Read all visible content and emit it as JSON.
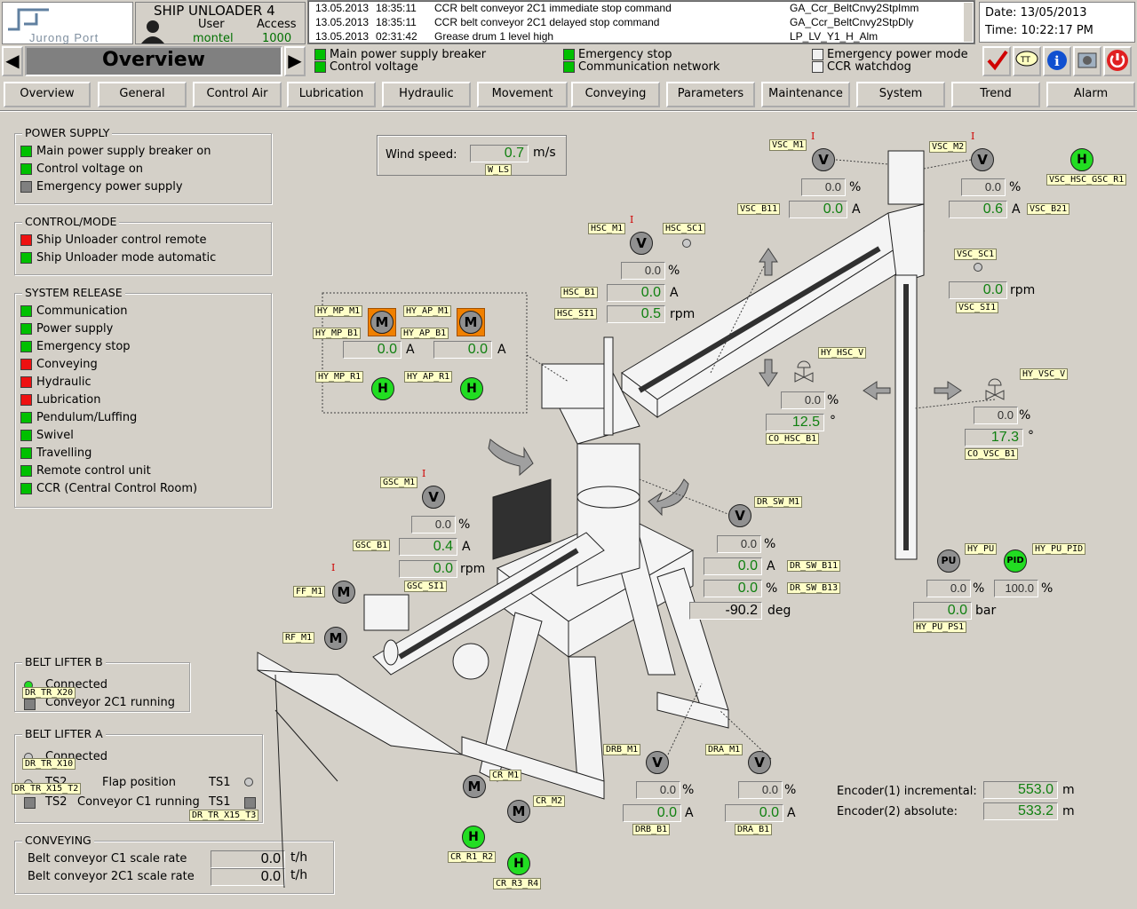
{
  "header": {
    "logo_text": "Jurong Port",
    "title": "SHIP UNLOADER 4",
    "user_label": "User",
    "user_value": "montel",
    "access_label": "Access",
    "access_value": "1000",
    "date": "Date: 13/05/2013",
    "time": "Time: 10:22:17 PM",
    "screen_title": "Overview"
  },
  "alarms": [
    {
      "date": "13.05.2013",
      "time": "18:35:11",
      "text": "CCR belt conveyor 2C1 immediate stop command",
      "tag": "GA_Ccr_BeltCnvy2StpImm"
    },
    {
      "date": "13.05.2013",
      "time": "18:35:11",
      "text": "CCR belt conveyor 2C1 delayed stop command",
      "tag": "GA_Ccr_BeltCnvy2StpDly"
    },
    {
      "date": "13.05.2013",
      "time": "02:31:42",
      "text": "Grease drum 1 level high",
      "tag": "LP_LV_Y1_H_Alm"
    }
  ],
  "status": {
    "c1": [
      "Main power supply breaker",
      "Control voltage"
    ],
    "c2": [
      "Emergency stop",
      "Communication network"
    ],
    "c3": [
      "Emergency power mode",
      "CCR watchdog"
    ]
  },
  "nav": [
    "Overview",
    "General",
    "Control Air",
    "Lubrication",
    "Hydraulic",
    "Movement",
    "Conveying",
    "Parameters",
    "Maintenance",
    "System",
    "Trend",
    "Alarm"
  ],
  "power_supply": {
    "title": "POWER SUPPLY",
    "items": [
      "Main power supply breaker on",
      "Control voltage on",
      "Emergency power supply"
    ]
  },
  "control_mode": {
    "title": "CONTROL/MODE",
    "items": [
      "Ship Unloader control remote",
      "Ship Unloader mode automatic"
    ]
  },
  "system_release": {
    "title": "SYSTEM RELEASE",
    "items": [
      "Communication",
      "Power supply",
      "Emergency stop",
      "Conveying",
      "Hydraulic",
      "Lubrication",
      "Pendulum/Luffing",
      "Swivel",
      "Travelling",
      "Remote control unit",
      "CCR (Central Control Room)"
    ]
  },
  "belt_lifter_b": {
    "title": "BELT LIFTER B",
    "items": [
      "Connected",
      "Conveyor 2C1 running"
    ],
    "tag": "DR_TR_X20"
  },
  "belt_lifter_a": {
    "title": "BELT LIFTER A",
    "connected": "Connected",
    "ts2a": "TS2",
    "flap": "Flap position",
    "ts1a": "TS1",
    "ts2b": "TS2",
    "conv": "Conveyor C1 running",
    "ts1b": "TS1",
    "tags": [
      "DR_TR_X10",
      "DR_TR_X15_T2",
      "DR_TR_X15_T3"
    ]
  },
  "conveying": {
    "title": "CONVEYING",
    "c1": "Belt conveyor C1 scale rate",
    "c1_val": "0.0",
    "c2": "Belt conveyor 2C1 scale rate",
    "c2_val": "0.0",
    "unit": "t/h"
  },
  "wind": {
    "label": "Wind speed:",
    "value": "0.7",
    "unit": "m/s",
    "tag": "W_LS"
  },
  "hyd": {
    "mp_m1": "HY_MP_M1",
    "ap_m1": "HY_AP_M1",
    "mp_b1": "HY_MP_B1",
    "ap_b1": "HY_AP_B1",
    "mp_val": "0.0",
    "ap_val": "0.0",
    "amp": "A",
    "mp_r1": "HY_MP_R1",
    "ap_r1": "HY_AP_R1"
  },
  "hsc": {
    "m1": "HSC_M1",
    "sc1": "HSC_SC1",
    "pct": "0.0",
    "b1": "HSC_B1",
    "b1_val": "0.0",
    "si1": "HSC_SI1",
    "si1_val": "0.5",
    "rpm": "rpm"
  },
  "vsc": {
    "m1": "VSC_M1",
    "m2": "VSC_M2",
    "pct1": "0.0",
    "pct2": "0.0",
    "b11": "VSC_B11",
    "b11_val": "0.0",
    "b21": "VSC_B21",
    "b21_val": "0.6",
    "hsc_gsc": "VSC_HSC_GSC_R1",
    "sc1": "VSC_SC1",
    "si1": "VSC_SI1",
    "si1_val": "0.0"
  },
  "hy_hsc_v": {
    "tag": "HY_HSC_V",
    "pct": "0.0",
    "deg": "12.5",
    "co": "CO_HSC_B1"
  },
  "hy_vsc_v": {
    "tag": "HY_VSC_V",
    "pct": "0.0",
    "deg": "17.3",
    "co": "CO_VSC_B1"
  },
  "gsc": {
    "m1": "GSC_M1",
    "pct": "0.0",
    "b1": "GSC_B1",
    "b1_val": "0.4",
    "si1": "GSC_SI1",
    "si1_val": "0.0"
  },
  "ff": "FF_M1",
  "rf": "RF_M1",
  "dr_sw": {
    "m1": "DR_SW_M1",
    "pct": "0.0",
    "b11": "DR_SW_B11",
    "b11_val": "0.0",
    "b13": "DR_SW_B13",
    "b13_val": "0.0",
    "deg_val": "-90.2",
    "deg": "deg"
  },
  "hy_pu": {
    "pu": "PU",
    "pid": "PID",
    "tag": "HY_PU",
    "tag_pid": "HY_PU_PID",
    "pct1": "0.0",
    "pct2": "100.0",
    "bar_val": "0.0",
    "bar": "bar",
    "ps1": "HY_PU_PS1"
  },
  "drb": {
    "m1": "DRB_M1",
    "pct": "0.0",
    "val": "0.0",
    "b1": "DRB_B1"
  },
  "dra": {
    "m1": "DRA_M1",
    "pct": "0.0",
    "val": "0.0",
    "b1": "DRA_B1"
  },
  "cr": {
    "m1": "CR_M1",
    "m2": "CR_M2",
    "r1r2": "CR_R1_R2",
    "r3r4": "CR_R3_R4"
  },
  "encoder": {
    "l1": "Encoder(1) incremental:",
    "v1": "553.0",
    "l2": "Encoder(2) absolute:",
    "v2": "533.2",
    "unit": "m"
  },
  "symbols": {
    "v": "V",
    "m": "M",
    "h": "H",
    "i": "I",
    "pct": "%",
    "a": "A",
    "deg": "°"
  }
}
